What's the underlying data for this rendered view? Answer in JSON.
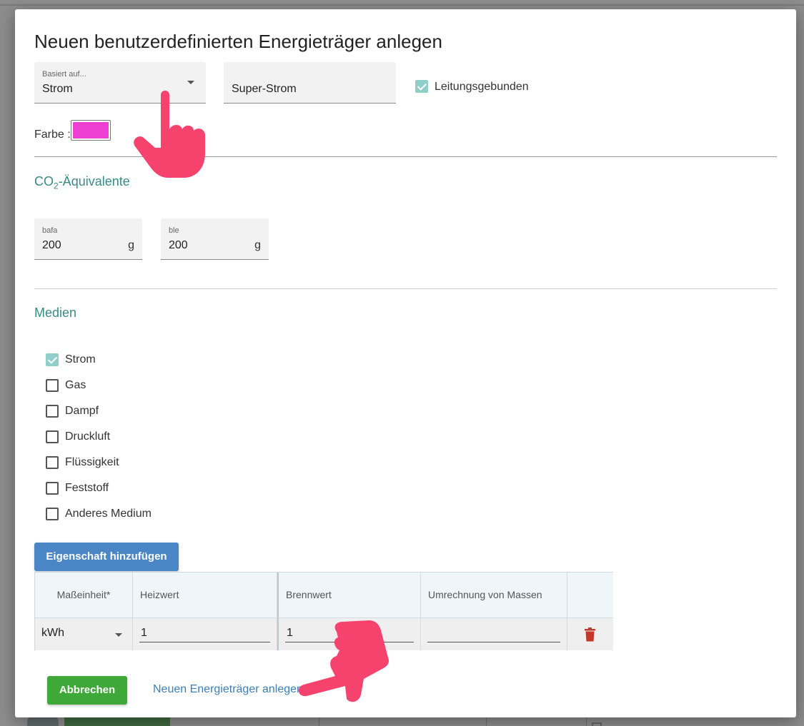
{
  "dialog": {
    "title": "Neuen benutzerdefinierten Energieträger anlegen"
  },
  "base_field": {
    "label": "Basiert auf...",
    "value": "Strom"
  },
  "name_field": {
    "value": "Super-Strom"
  },
  "wired_checkbox": {
    "label": "Leitungsgebunden",
    "checked": true
  },
  "color": {
    "label": "Farbe :",
    "value": "#ee3fd3"
  },
  "co2_section": {
    "title_prefix": "CO",
    "title_sub": "2",
    "title_suffix": "-Äquivalente",
    "fields": [
      {
        "label": "bafa",
        "value": "200",
        "unit": "g"
      },
      {
        "label": "ble",
        "value": "200",
        "unit": "g"
      }
    ]
  },
  "media_section": {
    "title": "Medien",
    "items": [
      {
        "label": "Strom",
        "checked": true
      },
      {
        "label": "Gas",
        "checked": false
      },
      {
        "label": "Dampf",
        "checked": false
      },
      {
        "label": "Druckluft",
        "checked": false
      },
      {
        "label": "Flüssigkeit",
        "checked": false
      },
      {
        "label": "Feststoff",
        "checked": false
      },
      {
        "label": "Anderes Medium",
        "checked": false
      }
    ]
  },
  "add_property_button": "Eigenschaft hinzufügen",
  "table": {
    "headers": [
      "Maßeinheit*",
      "Heizwert",
      "Brennwert",
      "Umrechnung von Massen"
    ],
    "row": {
      "unit": "kWh",
      "heizwert": "1",
      "brennwert": "1",
      "umrechnung": ""
    }
  },
  "footer": {
    "cancel": "Abbrechen",
    "create": "Neuen Energieträger anlegen"
  },
  "colors": {
    "accent_teal": "#3a8a86",
    "checkbox_checked": "#90cec9",
    "primary_blue": "#4a86c5",
    "success_green": "#3ea839",
    "link_blue": "#3d7fb5",
    "delete_red": "#c0392b",
    "pointer_pink": "#f5436e"
  }
}
